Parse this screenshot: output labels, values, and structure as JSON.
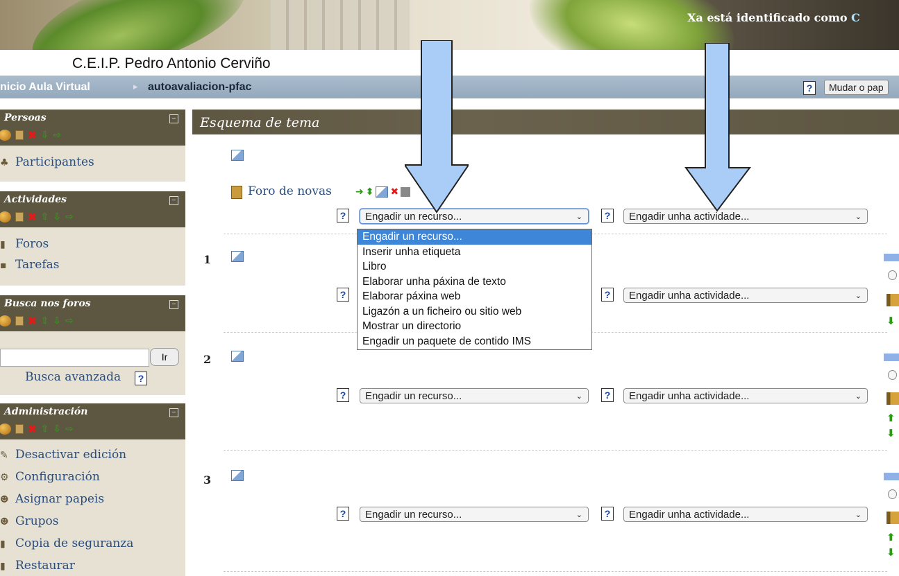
{
  "header": {
    "login_text": "Xa está identificado como ",
    "login_link_fragment": "C",
    "site_title": "C.E.I.P. Pedro Antonio Cerviño"
  },
  "navbar": {
    "breadcrumb_home": "nicio Aula Virtual",
    "breadcrumb_sep": "▸",
    "breadcrumb_course": "autoavaliacion-pfac",
    "help_glyph": "?",
    "switch_role_label": "Mudar o pap"
  },
  "sidebar": {
    "persoas": {
      "title": "Persoas",
      "links": [
        "Participantes"
      ]
    },
    "actividades": {
      "title": "Actividades",
      "links": [
        "Foros",
        "Tarefas"
      ]
    },
    "busca": {
      "title": "Busca nos foros",
      "go_label": "Ir",
      "search_value": "",
      "advanced_label": "Busca avanzada"
    },
    "administracion": {
      "title": "Administración",
      "links": [
        "Desactivar edición",
        "Configuración",
        "Asignar papeis",
        "Grupos",
        "Copia de seguranza",
        "Restaurar"
      ]
    },
    "toggle_glyph": "−"
  },
  "main": {
    "header_title": "Esquema de tema",
    "forum_label": "Foro de novas",
    "add_resource_placeholder": "Engadir un recurso...",
    "add_activity_placeholder": "Engadir unha actividade...",
    "sections": [
      "1",
      "2",
      "3"
    ],
    "dropdown_options": [
      "Engadir un recurso...",
      "Inserir unha etiqueta",
      "Libro",
      "Elaborar unha páxina de texto",
      "Elaborar páxina web",
      "Ligazón a un ficheiro ou sitio web",
      "Mostrar un directorio",
      "Engadir un paquete de contido IMS"
    ],
    "dropdown_selected_index": 0
  },
  "colors": {
    "block_header": "#5d5641",
    "block_body": "#e6e1d3",
    "link": "#2b4c79",
    "navbar": "#9fb3c7",
    "selected_option": "#3d86d8",
    "callout_arrow": "#a9cdf7"
  },
  "icons": {
    "users": "users-icon",
    "page": "page-icon",
    "delete": "delete-icon",
    "move_up": "arrow-up-icon",
    "move_down": "arrow-down-icon",
    "move_right": "arrow-right-icon",
    "edit": "edit-icon",
    "help": "help-icon"
  }
}
